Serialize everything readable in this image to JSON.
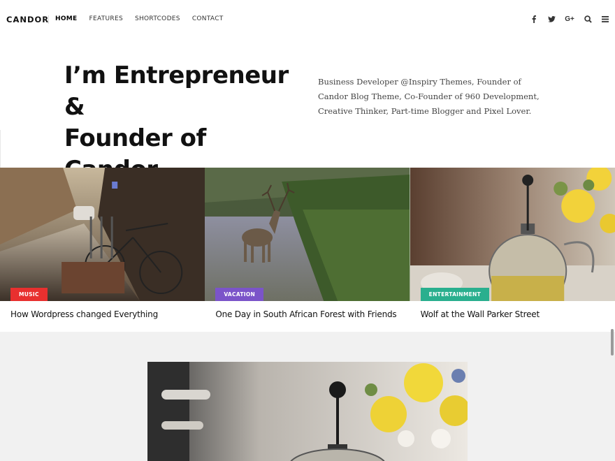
{
  "header": {
    "logo": "CANDOR",
    "nav": [
      {
        "label": "HOME",
        "active": true
      },
      {
        "label": "FEATURES",
        "active": false
      },
      {
        "label": "SHORTCODES",
        "active": false
      },
      {
        "label": "CONTACT",
        "active": false
      }
    ],
    "icons": [
      "facebook-icon",
      "twitter-icon",
      "google-plus-icon",
      "search-icon",
      "menu-icon"
    ],
    "google_plus_label": "G+"
  },
  "hero": {
    "title_line1": "I’m Entrepreneur &",
    "title_line2": "Founder of Candor",
    "description": "Business Developer @Inspiry Themes, Founder of Candor Blog Theme, Co-Founder of 960 Development, Creative Thinker, Part-time Blogger and Pixel Lover."
  },
  "posts": [
    {
      "category": "MUSIC",
      "category_color": "#e8302f",
      "title": "How Wordpress changed Everything",
      "image": "street-bicycles"
    },
    {
      "category": "VACATION",
      "category_color": "#7b54c9",
      "title": "One Day in South African Forest with Friends",
      "image": "deer-in-river"
    },
    {
      "category": "ENTERTAINMENT",
      "category_color": "#2aaf8e",
      "title": "Wolf at the Wall Parker Street",
      "image": "tea-press-flowers"
    }
  ],
  "feature": {
    "image": "tea-press-flowers-large"
  },
  "colors": {
    "lower_bg": "#f1f1f1",
    "text": "#111111"
  }
}
